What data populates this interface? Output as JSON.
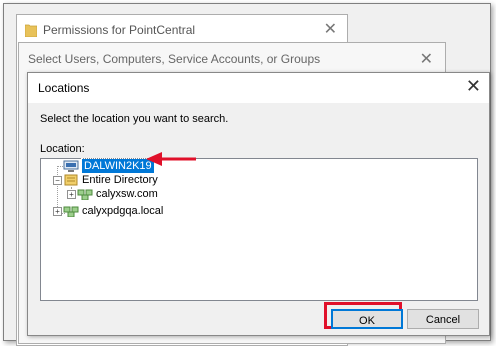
{
  "back_window_1": {
    "title": "Permissions for PointCentral",
    "close_glyph": "✕"
  },
  "back_window_2": {
    "title": "Select Users, Computers, Service Accounts, or Groups",
    "close_glyph": "✕",
    "bottom_text": ""
  },
  "dialog": {
    "title": "Locations",
    "close_glyph": "✕",
    "prompt": "Select the location you want to search.",
    "location_label": "Location:",
    "tree": [
      {
        "label": "DALWIN2K19",
        "icon": "computer-icon",
        "selected": true,
        "expander": ""
      },
      {
        "label": "Entire Directory",
        "icon": "directory-icon",
        "selected": false,
        "expander": "−"
      },
      {
        "label": "calyxsw.com",
        "icon": "domain-icon",
        "selected": false,
        "expander": "+"
      },
      {
        "label": "calyxpdgqa.local",
        "icon": "domain-icon",
        "selected": false,
        "expander": "+"
      }
    ],
    "ok_label": "OK",
    "cancel_label": "Cancel"
  },
  "colors": {
    "selection": "#0078d7",
    "annotation_red": "#e0102a"
  }
}
